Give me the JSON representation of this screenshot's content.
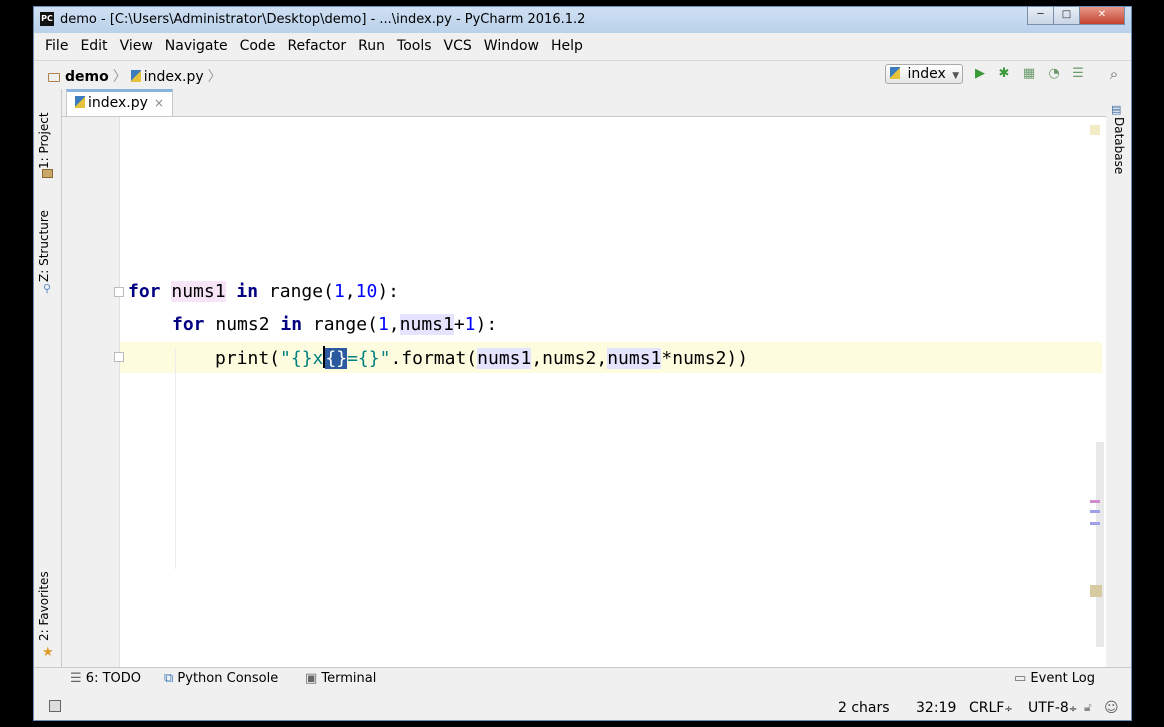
{
  "window": {
    "title": "demo - [C:\\Users\\Administrator\\Desktop\\demo] - ...\\index.py - PyCharm 2016.1.2",
    "app_icon": "PC",
    "minimize": "─",
    "maximize": "□",
    "close": "✕"
  },
  "menu": [
    "File",
    "Edit",
    "View",
    "Navigate",
    "Code",
    "Refactor",
    "Run",
    "Tools",
    "VCS",
    "Window",
    "Help"
  ],
  "breadcrumb": {
    "project": "demo",
    "file": "index.py"
  },
  "run_config": {
    "selected": "index"
  },
  "toolbar_icons": [
    "run-icon",
    "debug-icon",
    "coverage-icon",
    "profile-icon",
    "concurrency-icon",
    "search-icon"
  ],
  "left_tabs": {
    "project": "1: Project",
    "structure": "Z: Structure",
    "favorites": "2: Favorites"
  },
  "right_tabs": {
    "database": "Database"
  },
  "editor_tab": {
    "label": "index.py",
    "close": "×"
  },
  "code": {
    "line1": {
      "kw_for": "for",
      "var": "nums1",
      "kw_in": "in",
      "call": "range(",
      "n1": "1",
      "comma": ",",
      "n2": "10",
      "end": "):"
    },
    "line2": {
      "kw_for": "for",
      "var": "nums2",
      "kw_in": "in",
      "call": "range(",
      "n1": "1",
      "comma": ",",
      "ref": "nums1",
      "plus": "+",
      "n2": "1",
      "end": "):"
    },
    "line3": {
      "fn": "print(",
      "str_a": "\"{}x",
      "str_sel": "{}",
      "str_b": "={}\"",
      "method": ".format(",
      "arg1": "nums1",
      "c1": ",",
      "arg2": "nums2",
      "c2": ",",
      "arg3": "nums1",
      "rest": "*nums2))"
    }
  },
  "bottom_tabs": {
    "todo": "6: TODO",
    "console": "Python Console",
    "terminal": "Terminal",
    "event_log": "Event Log"
  },
  "status": {
    "selection": "2 chars",
    "position": "32:19",
    "line_sep": "CRLF",
    "encoding": "UTF-8"
  }
}
